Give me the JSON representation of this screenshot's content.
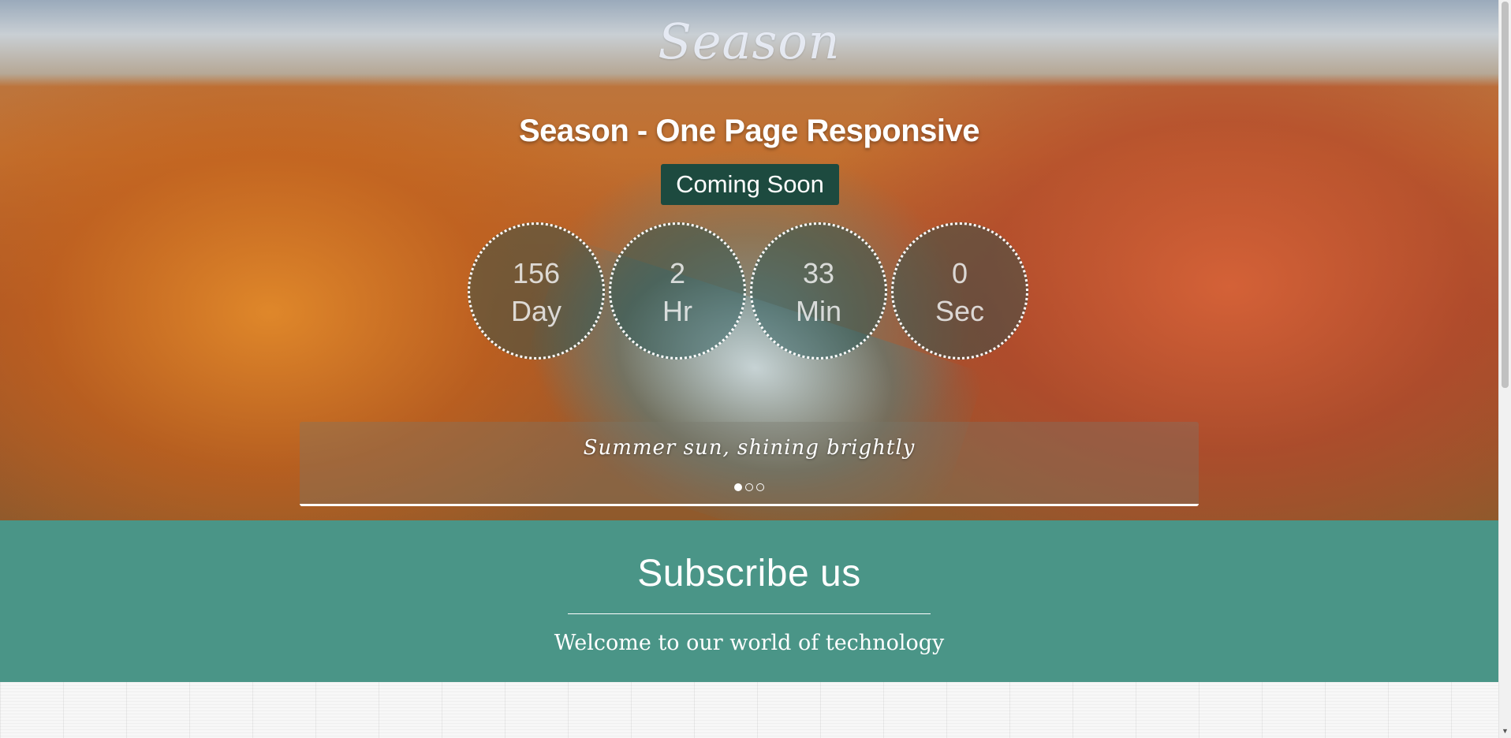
{
  "hero": {
    "logo": "Season",
    "title": "Season - One Page Responsive",
    "coming_soon": "Coming Soon",
    "countdown": [
      {
        "value": "156",
        "unit": "Day"
      },
      {
        "value": "2",
        "unit": "Hr"
      },
      {
        "value": "33",
        "unit": "Min"
      },
      {
        "value": "0",
        "unit": "Sec"
      }
    ],
    "slider": {
      "caption": "Summer sun, shining brightly",
      "dot_count": 3,
      "active_dot": 0
    }
  },
  "subscribe": {
    "title": "Subscribe us",
    "subtitle": "Welcome to our world of technology"
  },
  "colors": {
    "subscribe_bg": "#4a9587",
    "coming_soon_bg": "#1d4a3f",
    "circle_border": "#ffffff"
  },
  "icons": {
    "scroll_down": "scroll-down-arrow-icon"
  }
}
